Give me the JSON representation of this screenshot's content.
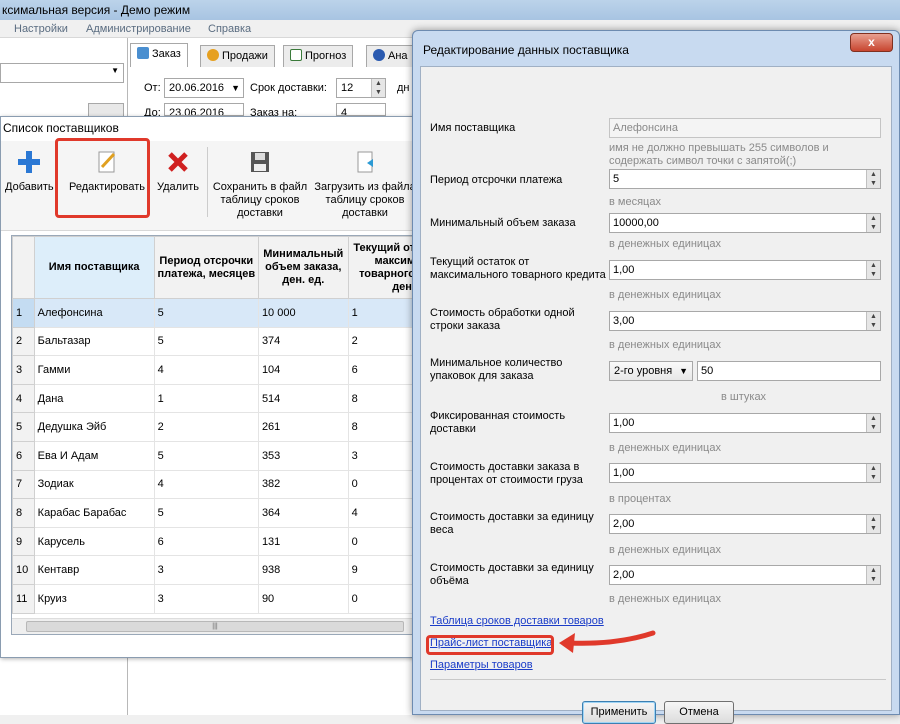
{
  "app": {
    "title": "ксимальная версия - Демо режим",
    "menu": [
      "Настройки",
      "Администрирование",
      "Справка"
    ]
  },
  "tabs": [
    "Заказ",
    "Продажи",
    "Прогноз",
    "Ана"
  ],
  "order_params": {
    "from_label": "От:",
    "from_date": "20.06.2016",
    "to_label": "До:",
    "to_date": "23.06.2016",
    "delivery_label": "Срок доставки:",
    "delivery_value": "12",
    "order_for_label": "Заказ на:",
    "order_for_value": "4",
    "days_suffix": "дн"
  },
  "supplier_list": {
    "title": "Список поставщиков",
    "toolbar": {
      "add": "Добавить",
      "edit": "Редактировать",
      "delete": "Удалить",
      "save": "Сохранить в файл таблицу сроков доставки",
      "load": "Загрузить из файла таблицу сроков доставки"
    },
    "columns": [
      "Имя поставщика",
      "Период отсрочки платежа, месяцев",
      "Минимальный объем заказа, ден. ед.",
      "Текущий от максим товарного ден."
    ],
    "rows": [
      {
        "n": "1",
        "name": "Алефонсина",
        "period": "5",
        "min": "10 000",
        "cur": "1"
      },
      {
        "n": "2",
        "name": "Бальтазар",
        "period": "5",
        "min": "374",
        "cur": "2"
      },
      {
        "n": "3",
        "name": "Гамми",
        "period": "4",
        "min": "104",
        "cur": "6"
      },
      {
        "n": "4",
        "name": "Дана",
        "period": "1",
        "min": "514",
        "cur": "8"
      },
      {
        "n": "5",
        "name": "Дедушка Эйб",
        "period": "2",
        "min": "261",
        "cur": "8"
      },
      {
        "n": "6",
        "name": "Ева И Адам",
        "period": "5",
        "min": "353",
        "cur": "3"
      },
      {
        "n": "7",
        "name": "Зодиак",
        "period": "4",
        "min": "382",
        "cur": "0"
      },
      {
        "n": "8",
        "name": "Карабас Барабас",
        "period": "5",
        "min": "364",
        "cur": "4"
      },
      {
        "n": "9",
        "name": "Карусель",
        "period": "6",
        "min": "131",
        "cur": "0"
      },
      {
        "n": "10",
        "name": "Кентавр",
        "period": "3",
        "min": "938",
        "cur": "9"
      },
      {
        "n": "11",
        "name": "Круиз",
        "period": "3",
        "min": "90",
        "cur": "0"
      }
    ]
  },
  "dialog": {
    "title": "Редактирование данных поставщика",
    "close": "x",
    "fields": {
      "name_label": "Имя поставщика",
      "name_value": "Алефонсина",
      "name_hint": "имя не должно превышать 255 символов и содержать символ точки с запятой(;)",
      "period_label": "Период отсрочки платежа",
      "period_value": "5",
      "period_hint": "в месяцах",
      "minorder_label": "Минимальный объем заказа",
      "minorder_value": "10000,00",
      "minorder_hint": "в денежных единицах",
      "credit_label": "Текущий остаток от максимального товарного кредита",
      "credit_value": "1,00",
      "credit_hint": "в денежных единицах",
      "line_cost_label": "Стоимость обработки одной строки заказа",
      "line_cost_value": "3,00",
      "line_cost_hint": "в денежных единицах",
      "min_packs_label": "Минимальное количество упаковок для заказа",
      "min_packs_level": "2-го уровня",
      "min_packs_value": "50",
      "min_packs_hint": "в штуках",
      "fixed_delivery_label": "Фиксированная стоимость доставки",
      "fixed_delivery_value": "1,00",
      "fixed_delivery_hint": "в денежных единицах",
      "pct_delivery_label": "Стоимость доставки заказа в процентах от стоимости груза",
      "pct_delivery_value": "1,00",
      "pct_delivery_hint": "в процентах",
      "weight_delivery_label": "Стоимость доставки за единицу веса",
      "weight_delivery_value": "2,00",
      "weight_delivery_hint": "в денежных единицах",
      "volume_delivery_label": "Стоимость доставки за единицу объёма",
      "volume_delivery_value": "2,00",
      "volume_delivery_hint": "в денежных единицах"
    },
    "links": {
      "delivery_table": "Таблица сроков доставки товаров",
      "price_list": "Прайс-лист поставщика",
      "product_params": "Параметры товаров"
    },
    "buttons": {
      "apply": "Применить",
      "cancel": "Отмена"
    }
  },
  "colors": {
    "highlight": "#e0392b",
    "link": "#1a3cc8"
  }
}
